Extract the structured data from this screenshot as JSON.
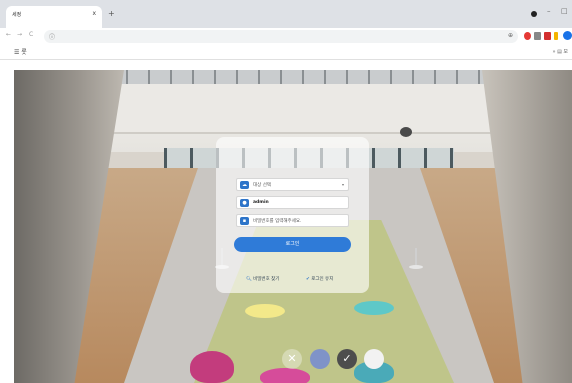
{
  "browser": {
    "tab_title": "세정",
    "tab_close": "x",
    "new_tab": "+",
    "window_controls": [
      "–",
      "□"
    ],
    "nav": {
      "back": "←",
      "forward": "→",
      "reload": "C"
    },
    "omnibox_icon": "ⓘ",
    "bookmark_label": "☰ 롯",
    "bookmarks_right": "» ▤ 모"
  },
  "login": {
    "select_placeholder": "대상 선택",
    "username": "admin",
    "password_placeholder": "비밀번호를 입력해주세요.",
    "login_button": "로그인",
    "find_password": "비밀번호 찾기",
    "remember_login": "로그인 유지"
  },
  "bottom_icons": [
    "close-icon",
    "blue-circle-icon",
    "check-icon",
    "white-circle-icon"
  ],
  "colors": {
    "accent": "#2f7bd8",
    "icon_blue": "#2d74c9"
  }
}
